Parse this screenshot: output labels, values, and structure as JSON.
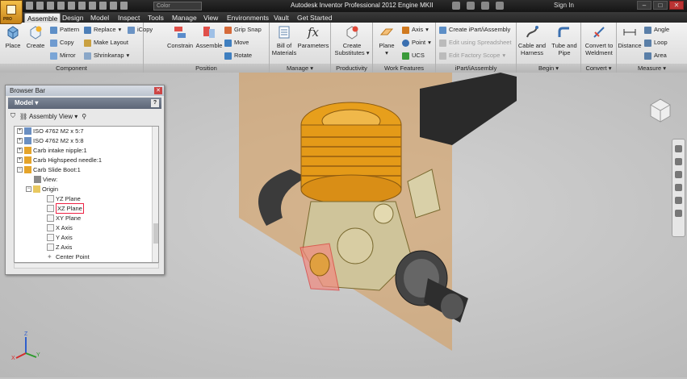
{
  "app": {
    "title": "Autodesk Inventor Professional 2012   Engine MKII",
    "logo_text": "PRO",
    "color_selector": "Color",
    "sign_in": "Sign In"
  },
  "tabs": [
    "Assemble",
    "Design",
    "Model",
    "Inspect",
    "Tools",
    "Manage",
    "View",
    "Environments",
    "Vault",
    "Get Started"
  ],
  "ribbon": {
    "component": {
      "label": "Component",
      "place": "Place",
      "create": "Create",
      "pattern": "Pattern",
      "copy": "Copy",
      "mirror": "Mirror",
      "replace": "Replace",
      "make_layout": "Make Layout",
      "shrinkwrap": "Shrinkwrap",
      "icopy": "iCopy"
    },
    "position": {
      "label": "Position",
      "constrain": "Constrain",
      "assemble": "Assemble",
      "grip_snap": "Grip Snap",
      "move": "Move",
      "rotate": "Rotate"
    },
    "manage": {
      "label": "Manage",
      "bill_line1": "Bill of",
      "bill_line2": "Materials",
      "parameters": "Parameters"
    },
    "productivity": {
      "label": "Productivity",
      "create_line1": "Create",
      "create_line2": "Substitutes"
    },
    "work_features": {
      "label": "Work Features",
      "plane": "Plane",
      "axis": "Axis",
      "point": "Point",
      "ucs": "UCS"
    },
    "ipart": {
      "label": "iPart/iAssembly",
      "create": "Create iPart/iAssembly",
      "edit_spreadsheet": "Edit using Spreadsheet",
      "edit_factory": "Edit Factory Scope"
    },
    "begin": {
      "label": "Begin",
      "cable_line1": "Cable and",
      "cable_line2": "Harness",
      "tube_line1": "Tube and",
      "tube_line2": "Pipe"
    },
    "convert": {
      "label": "Convert",
      "conv_line1": "Convert to",
      "conv_line2": "Weldment"
    },
    "measure": {
      "label": "Measure",
      "distance": "Distance",
      "angle": "Angle",
      "loop": "Loop",
      "area": "Area"
    }
  },
  "browser": {
    "title": "Browser Bar",
    "model": "Model",
    "view_mode": "Assembly View",
    "items": [
      {
        "label": "ISO 4762 M2 x 5:7"
      },
      {
        "label": "ISO 4762 M2 x 5:8"
      },
      {
        "label": "Carb intake nipple:1"
      },
      {
        "label": "Carb Highspeed needle:1"
      },
      {
        "label": "Carb Slide Boot:1"
      },
      {
        "label": "View:"
      },
      {
        "label": "Origin"
      },
      {
        "label": "YZ Plane"
      },
      {
        "label": "XZ Plane"
      },
      {
        "label": "XY Plane"
      },
      {
        "label": "X Axis"
      },
      {
        "label": "Y Axis"
      },
      {
        "label": "Z Axis"
      },
      {
        "label": "Center Point"
      }
    ]
  },
  "axes": {
    "x": "X",
    "y": "Y",
    "z": "Z"
  }
}
